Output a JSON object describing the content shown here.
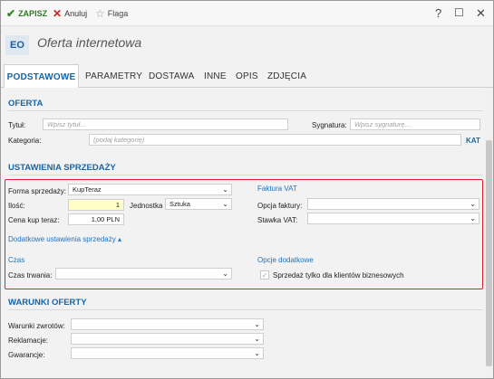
{
  "toolbar": {
    "save_label": "ZAPISZ",
    "cancel_label": "Anuluj",
    "flag_label": "Flaga",
    "help": "?",
    "maximize": "☐",
    "close": "✕"
  },
  "header": {
    "badge": "EO",
    "title": "Oferta internetowa"
  },
  "tabs": [
    "PODSTAWOWE",
    "PARAMETRY",
    "DOSTAWA",
    "INNE",
    "OPIS",
    "ZDJĘCIA"
  ],
  "oferta": {
    "title": "OFERTA",
    "tytul_label": "Tytuł:",
    "tytul_placeholder": "Wpisz tytuł...",
    "sygnatura_label": "Sygnatura:",
    "sygnatura_placeholder": "Wpisz sygnaturę...",
    "kategoria_label": "Kategoria:",
    "kategoria_placeholder": "(podaj kategorię)",
    "kat_button": "KAT"
  },
  "sprzedaz": {
    "title": "USTAWIENIA SPRZEDAŻY",
    "forma_label": "Forma sprzedaży:",
    "forma_value": "KupTeraz",
    "ilosc_label": "Ilość:",
    "ilosc_value": "1",
    "jednostka_label": "Jednostka",
    "jednostka_value": "Sztuka",
    "cena_label": "Cena kup teraz:",
    "cena_value": "1,00 PLN",
    "dodatkowe_label": "Dodatkowe ustawienia sprzedaży ▴",
    "faktura_title": "Faktura VAT",
    "opcja_faktury_label": "Opcja faktury:",
    "opcja_faktury_value": "",
    "stawka_vat_label": "Stawka VAT:",
    "stawka_vat_value": "",
    "czas_title": "Czas",
    "czas_trwania_label": "Czas trwania:",
    "czas_trwania_value": "",
    "opcje_title": "Opcje dodatkowe",
    "biznes_checkbox_label": "Sprzedaż tylko dla klientów biznesowych"
  },
  "warunki": {
    "title": "WARUNKI OFERTY",
    "zwrotow_label": "Warunki zwrotów:",
    "reklamacje_label": "Reklamacje:",
    "gwarancje_label": "Gwarancje:"
  },
  "colors": {
    "accent": "#1565a8",
    "highlight_border": "#e0202a",
    "save_green": "#2d7d1e",
    "cancel_red": "#d02020",
    "quantity_bg": "#fffdc8"
  },
  "icons": {
    "save": "check-icon",
    "cancel": "x-icon",
    "flag": "star-icon",
    "dropdown": "chevron-down-icon"
  }
}
